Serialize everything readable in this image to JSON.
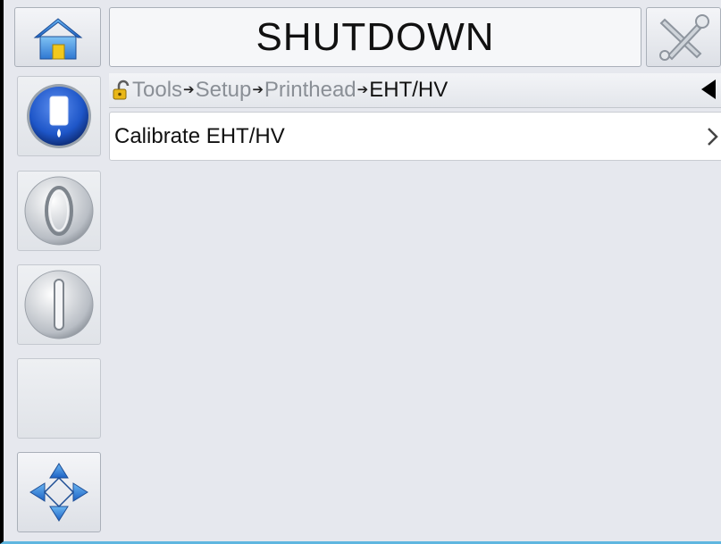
{
  "header": {
    "title": "SHUTDOWN",
    "home_icon": "home-icon",
    "tools_icon": "tools-icon"
  },
  "breadcrumb": {
    "items": [
      "Tools",
      "Setup",
      "Printhead",
      "EHT/HV"
    ],
    "lock_icon": "unlock-icon",
    "back_icon": "back-triangle-icon"
  },
  "menu": {
    "items": [
      {
        "label": "Calibrate EHT/HV",
        "icon": "chevron-right-icon"
      }
    ]
  },
  "sidebar": {
    "buttons": [
      {
        "name": "ink-status-button",
        "icon": "ink-bottle-icon"
      },
      {
        "name": "start-button",
        "icon": "start-circle-icon"
      },
      {
        "name": "stop-button",
        "icon": "stop-circle-icon"
      },
      {
        "name": "empty-slot",
        "icon": ""
      },
      {
        "name": "navigation-button",
        "icon": "navigation-arrows-icon"
      }
    ]
  },
  "colors": {
    "background": "#e6e8ee",
    "accent_blue": "#1e56c8",
    "bottom_border": "#5fb6e0"
  }
}
